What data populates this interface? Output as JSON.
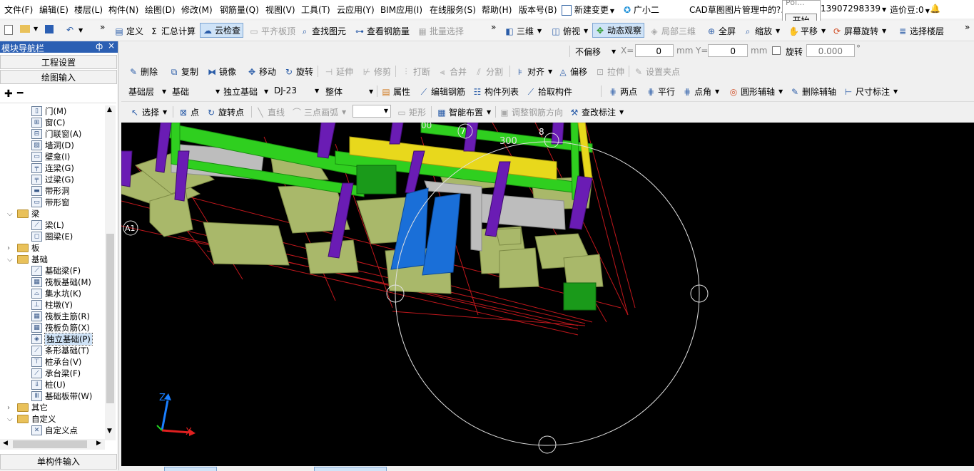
{
  "menubar": {
    "items": [
      "文件(F)",
      "编辑(E)",
      "楼层(L)",
      "构件(N)",
      "绘图(D)",
      "修改(M)",
      "钢筋量(Q)",
      "视图(V)",
      "工具(T)",
      "云应用(Y)",
      "BIM应用(I)",
      "在线服务(S)",
      "帮助(H)",
      "版本号(B)"
    ],
    "new_change": "新建变更",
    "guang_xiao_er": "广小二",
    "cad_notice": "CAD草图图片管理中的?.",
    "phone": "13907298339",
    "cost_beans": "造价豆:0"
  },
  "popup": {
    "top_text": "Poi...",
    "start_button": "开始"
  },
  "toolbar1": {
    "define": "定义",
    "summary": "汇总计算",
    "cloud_check": "云检查",
    "align_slab": "平齐板顶",
    "find_element": "查找图元",
    "view_rebar": "查看钢筋量",
    "batch_select": "批量选择",
    "three_d": "三维",
    "top_view": "俯视",
    "dynamic_view": "动态观察",
    "local_3d": "局部三维",
    "fullscreen": "全屏",
    "zoom": "缩放",
    "pan": "平移",
    "screen_rotate": "屏幕旋转",
    "select_floor": "选择楼层"
  },
  "offsetbar": {
    "offset_mode": "不偏移",
    "x_label": "X=",
    "x_value": "0",
    "unit_x": "mm",
    "y_label": "Y=",
    "y_value": "0",
    "unit_y": "mm",
    "rotate_label": "旋转",
    "rotate_value": "0.000",
    "degree": "°"
  },
  "toolbar2": {
    "delete": "删除",
    "copy": "复制",
    "mirror": "镜像",
    "move": "移动",
    "rotate": "旋转",
    "extend": "延伸",
    "trim": "修剪",
    "break": "打断",
    "merge": "合并",
    "split": "分割",
    "align": "对齐",
    "offset": "偏移",
    "stretch": "拉伸",
    "set_grip": "设置夹点"
  },
  "toolbar3": {
    "floor": "基础层",
    "category": "基础",
    "type": "独立基础",
    "element": "DJ-23",
    "part": "整体",
    "properties": "属性",
    "edit_rebar": "编辑钢筋",
    "element_list": "构件列表",
    "pick_element": "拾取构件",
    "two_points": "两点",
    "parallel": "平行",
    "point_angle": "点角",
    "circle_aux": "圆形辅轴",
    "delete_aux": "删除辅轴",
    "dim": "尺寸标注"
  },
  "toolbar4": {
    "select": "选择",
    "point": "点",
    "rotate_point": "旋转点",
    "line": "直线",
    "arc3": "三点画弧",
    "rect": "矩形",
    "smart_layout": "智能布置",
    "adjust_rebar_dir": "调整钢筋方向",
    "check_annot": "查改标注"
  },
  "nav": {
    "title": "模块导航栏",
    "pin": "ф",
    "close": "×",
    "project_settings": "工程设置",
    "drawing_input": "绘图输入",
    "single_input": "单构件输入",
    "tree": [
      {
        "label": "门(M)",
        "level": 2,
        "icon": "door"
      },
      {
        "label": "窗(C)",
        "level": 2,
        "icon": "window"
      },
      {
        "label": "门联窗(A)",
        "level": 2,
        "icon": "doorwin"
      },
      {
        "label": "墙洞(D)",
        "level": 2,
        "icon": "wallhole"
      },
      {
        "label": "壁龛(I)",
        "level": 2,
        "icon": "niche"
      },
      {
        "label": "连梁(G)",
        "level": 2,
        "icon": "linkbeam"
      },
      {
        "label": "过梁(G)",
        "level": 2,
        "icon": "lintel"
      },
      {
        "label": "带形洞",
        "level": 2,
        "icon": "striphole"
      },
      {
        "label": "带形窗",
        "level": 2,
        "icon": "stripwin"
      },
      {
        "label": "梁",
        "level": 1,
        "icon": "folder",
        "expanded": true
      },
      {
        "label": "梁(L)",
        "level": 2,
        "icon": "beam"
      },
      {
        "label": "圈梁(E)",
        "level": 2,
        "icon": "ringbeam"
      },
      {
        "label": "板",
        "level": 1,
        "icon": "folder",
        "expanded": false
      },
      {
        "label": "基础",
        "level": 1,
        "icon": "folder",
        "expanded": true
      },
      {
        "label": "基础梁(F)",
        "level": 2,
        "icon": "fbeam"
      },
      {
        "label": "筏板基础(M)",
        "level": 2,
        "icon": "raft"
      },
      {
        "label": "集水坑(K)",
        "level": 2,
        "icon": "sump"
      },
      {
        "label": "柱墩(Y)",
        "level": 2,
        "icon": "pier"
      },
      {
        "label": "筏板主筋(R)",
        "level": 2,
        "icon": "raftmain"
      },
      {
        "label": "筏板负筋(X)",
        "level": 2,
        "icon": "raftneg"
      },
      {
        "label": "独立基础(P)",
        "level": 2,
        "icon": "isolated",
        "selected": true
      },
      {
        "label": "条形基础(T)",
        "level": 2,
        "icon": "stripfound"
      },
      {
        "label": "桩承台(V)",
        "level": 2,
        "icon": "pilecap"
      },
      {
        "label": "承台梁(F)",
        "level": 2,
        "icon": "capbeam"
      },
      {
        "label": "桩(U)",
        "level": 2,
        "icon": "pile"
      },
      {
        "label": "基础板带(W)",
        "level": 2,
        "icon": "band"
      },
      {
        "label": "其它",
        "level": 1,
        "icon": "folder",
        "expanded": false
      },
      {
        "label": "自定义",
        "level": 1,
        "icon": "folder",
        "expanded": true
      },
      {
        "label": "自定义点",
        "level": 2,
        "icon": "custompt"
      }
    ]
  },
  "viewport": {
    "axis_labels": [
      "7",
      "8",
      "A1"
    ],
    "dim_300": "300",
    "dim_00": "00",
    "axis_z": "Z",
    "axis_x": "X"
  },
  "colors": {
    "nav_header": "#2b5fb3",
    "beam_green": "#2fcf1f",
    "column_purple": "#6a1cb4",
    "footing_olive": "#a9b86a",
    "blue_column": "#1a6fd8",
    "yellow_beam": "#e8d81c"
  }
}
